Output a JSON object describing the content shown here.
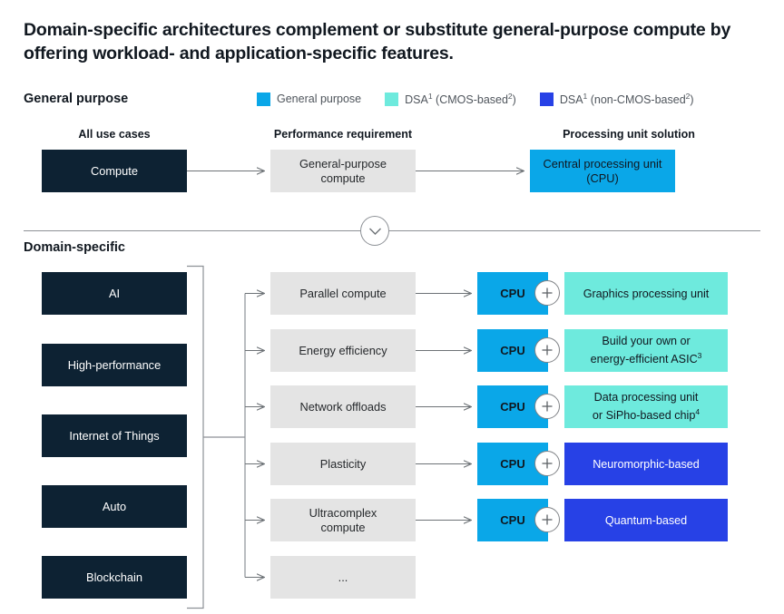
{
  "title": "Domain-specific architectures complement or substitute general-purpose compute by offering workload- and application-specific features.",
  "sections": {
    "general_label": "General purpose",
    "domain_label": "Domain-specific"
  },
  "legend": {
    "items": [
      {
        "label": "General purpose",
        "sup": "",
        "suffix": "",
        "color": "#0aa7e8",
        "swatch_name": "general-purpose-swatch"
      },
      {
        "label": "DSA",
        "sup": "1",
        "suffix": " (CMOS-based",
        "sup2": "2",
        "suffix2": ")",
        "color": "#6eeadd",
        "swatch_name": "dsa-cmos-swatch"
      },
      {
        "label": "DSA",
        "sup": "1",
        "suffix": " (non-CMOS-based",
        "sup2": "2",
        "suffix2": ")",
        "color": "#2741e6",
        "swatch_name": "dsa-non-cmos-swatch"
      }
    ]
  },
  "column_headers": {
    "use_cases": "All use cases",
    "performance": "Performance requirement",
    "solution": "Processing unit solution"
  },
  "general_purpose_row": {
    "use_case": "Compute",
    "requirement": "General-purpose compute",
    "requirement_line1": "General-purpose",
    "requirement_line2": "compute",
    "solution_line1": "Central processing unit",
    "solution_line2": "(CPU)"
  },
  "domain_use_cases": [
    {
      "label": "AI"
    },
    {
      "label": "High-performance"
    },
    {
      "label": "Internet of Things"
    },
    {
      "label": "Auto"
    },
    {
      "label": "Blockchain"
    }
  ],
  "requirements": [
    {
      "line1": "Parallel compute",
      "line2": ""
    },
    {
      "line1": "Energy efficiency",
      "line2": ""
    },
    {
      "line1": "Network offloads",
      "line2": ""
    },
    {
      "line1": "Plasticity",
      "line2": ""
    },
    {
      "line1": "Ultracomplex",
      "line2": "compute"
    },
    {
      "line1": "...",
      "line2": ""
    }
  ],
  "solutions": [
    {
      "cpu": "CPU",
      "plus": "+",
      "accel_line1": "Graphics processing unit",
      "accel_line2": "",
      "accel_sup": "",
      "type": "cmos",
      "color": "#6eeadd",
      "text_color": "#101820"
    },
    {
      "cpu": "CPU",
      "plus": "+",
      "accel_line1": "Build your own or",
      "accel_line2": "energy-efficient ASIC",
      "accel_sup": "3",
      "type": "cmos",
      "color": "#6eeadd",
      "text_color": "#101820"
    },
    {
      "cpu": "CPU",
      "plus": "+",
      "accel_line1": "Data processing unit",
      "accel_line2": "or SiPho-based chip",
      "accel_sup": "4",
      "type": "cmos",
      "color": "#6eeadd",
      "text_color": "#101820"
    },
    {
      "cpu": "CPU",
      "plus": "+",
      "accel_line1": "Neuromorphic-based",
      "accel_line2": "",
      "accel_sup": "",
      "type": "non-cmos",
      "color": "#2741e6",
      "text_color": "#ffffff"
    },
    {
      "cpu": "CPU",
      "plus": "+",
      "accel_line1": "Quantum-based",
      "accel_line2": "",
      "accel_sup": "",
      "type": "non-cmos",
      "color": "#2741e6",
      "text_color": "#ffffff"
    }
  ],
  "colors": {
    "dark_navy": "#0d2233",
    "grey_box": "#e4e4e4",
    "cyan": "#0aa7e8",
    "teal": "#6eeadd",
    "royal_blue": "#2741e6",
    "line": "#8d9196",
    "legend_text": "#4f555c"
  },
  "icons": {
    "chevron_down": "chevron-down-icon",
    "plus": "plus-icon",
    "arrow": "arrow-right-icon"
  }
}
